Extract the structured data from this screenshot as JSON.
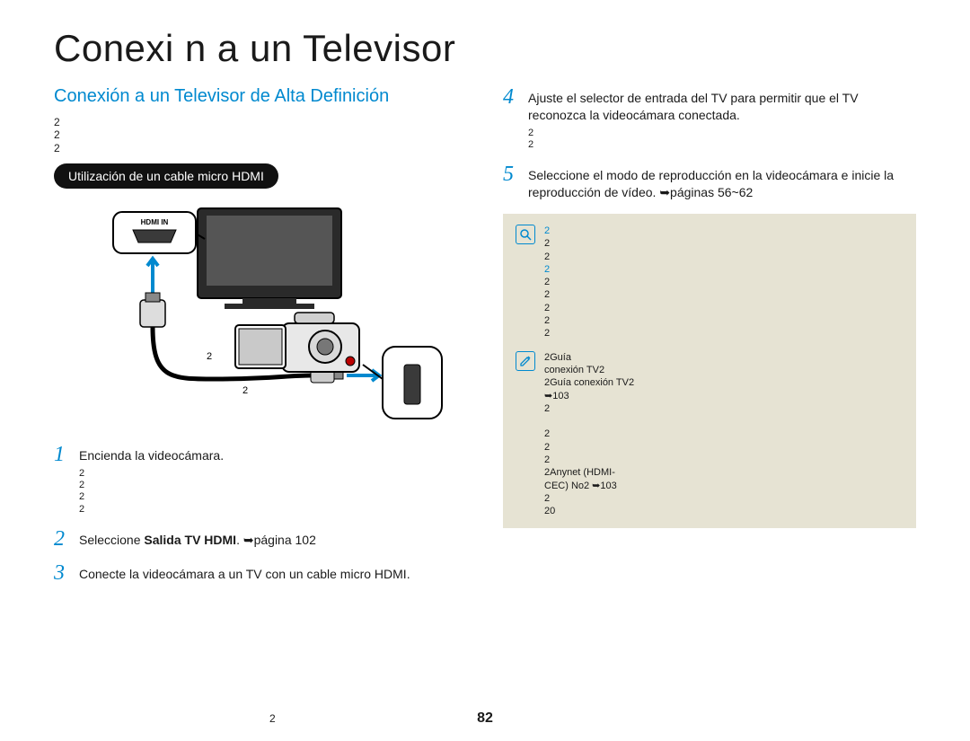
{
  "title": "Conexi n a un Televisor",
  "subtitle": "Conexión a un Televisor de Alta Definición",
  "intro_lines": "2\n2\n2",
  "pill": "Utilización de un cable micro HDMI",
  "diagram": {
    "hdmi_label": "HDMI IN",
    "cable_note_a": "2",
    "cable_note_b": "2"
  },
  "left_steps": [
    {
      "num": "1",
      "text": "Encienda la videocámara.",
      "sub": "2\n2\n2\n2"
    },
    {
      "num": "2",
      "text_prefix": "Seleccione ",
      "text_bold": "Salida TV HDMI",
      "text_suffix": ". ➥página 102"
    },
    {
      "num": "3",
      "text": "Conecte la videocámara a un TV con un cable micro HDMI."
    }
  ],
  "right_steps": [
    {
      "num": "4",
      "text": "Ajuste el selector de entrada del TV para permitir que el TV reconozca la videocámara conectada.",
      "sub": "2\n2"
    },
    {
      "num": "5",
      "text": "Seleccione el modo de reproducción en la videocámara e inicie la reproducción de vídeo. ➥páginas 56~62"
    }
  ],
  "note_q": {
    "line1": "2",
    "text": "2\n2",
    "line2": "2",
    "text2": "2\n2\n2\n2\n2"
  },
  "note_pencil": {
    "text": "2Guía\nconexión TV2\n2Guía conexión TV2\n➥103\n2\n\n2\n2\n2\n2Anynet  (HDMI-\nCEC) No2    ➥103\n2\n20"
  },
  "page_number": "82",
  "footer_two": "2"
}
